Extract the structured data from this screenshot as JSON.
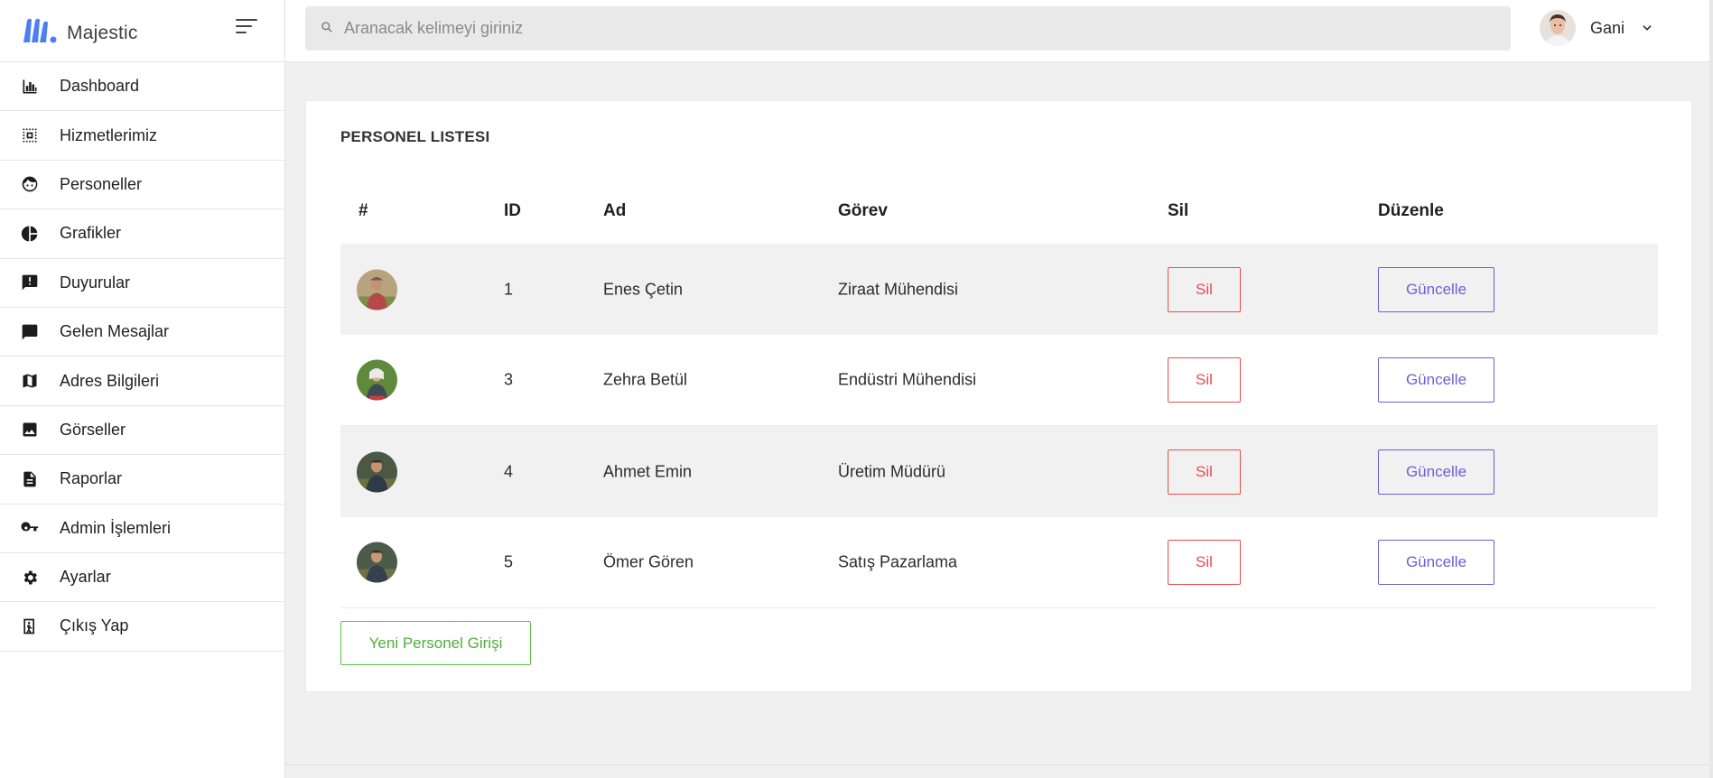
{
  "brand": {
    "name": "Majestic",
    "logo_color": "#4e7ff2"
  },
  "search": {
    "placeholder": "Aranacak kelimeyi giriniz"
  },
  "profile": {
    "name": "Gani"
  },
  "sidebar": {
    "items": [
      {
        "label": "Dashboard",
        "icon": "bar-chart-icon"
      },
      {
        "label": "Hizmetlerimiz",
        "icon": "select-all-icon"
      },
      {
        "label": "Personeller",
        "icon": "face-icon"
      },
      {
        "label": "Grafikler",
        "icon": "pie-chart-icon"
      },
      {
        "label": "Duyurular",
        "icon": "announcement-icon"
      },
      {
        "label": "Gelen Mesajlar",
        "icon": "message-icon"
      },
      {
        "label": "Adres Bilgileri",
        "icon": "map-icon"
      },
      {
        "label": "Görseller",
        "icon": "image-icon"
      },
      {
        "label": "Raporlar",
        "icon": "description-icon"
      },
      {
        "label": "Admin İşlemleri",
        "icon": "key-icon"
      },
      {
        "label": "Ayarlar",
        "icon": "settings-icon"
      },
      {
        "label": "Çıkış Yap",
        "icon": "exit-icon"
      }
    ]
  },
  "card": {
    "title": "PERSONEL LISTESI",
    "columns": [
      "#",
      "ID",
      "Ad",
      "Görev",
      "Sil",
      "Düzenle"
    ],
    "rows": [
      {
        "id": "1",
        "name": "Enes Çetin",
        "role": "Ziraat Mühendisi",
        "delete_label": "Sil",
        "update_label": "Güncelle"
      },
      {
        "id": "3",
        "name": "Zehra Betül",
        "role": "Endüstri Mühendisi",
        "delete_label": "Sil",
        "update_label": "Güncelle"
      },
      {
        "id": "4",
        "name": "Ahmet Emin",
        "role": "Üretim Müdürü",
        "delete_label": "Sil",
        "update_label": "Güncelle"
      },
      {
        "id": "5",
        "name": "Ömer Gören",
        "role": "Satış Pazarlama",
        "delete_label": "Sil",
        "update_label": "Güncelle"
      }
    ],
    "new_button": "Yeni Personel Girişi"
  },
  "colors": {
    "danger": "#ee4b4b",
    "primary": "#6b5fd6",
    "success": "#4fae3a",
    "stripe": "#f1f1f1"
  }
}
